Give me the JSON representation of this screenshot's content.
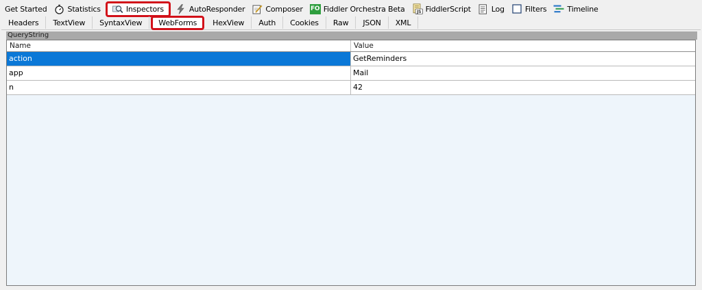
{
  "top_tabs": [
    {
      "label": "Get Started",
      "icon": "none"
    },
    {
      "label": "Statistics",
      "icon": "stopwatch-icon"
    },
    {
      "label": "Inspectors",
      "icon": "magnifier-icon",
      "active": true
    },
    {
      "label": "AutoResponder",
      "icon": "lightning-icon"
    },
    {
      "label": "Composer",
      "icon": "pencil-page-icon"
    },
    {
      "label": "Fiddler Orchestra Beta",
      "icon": "fo-icon",
      "icon_text": "FO"
    },
    {
      "label": "FiddlerScript",
      "icon": "js-script-icon",
      "icon_text": "JS"
    },
    {
      "label": "Log",
      "icon": "log-page-icon"
    },
    {
      "label": "Filters",
      "icon": "checkbox-icon"
    },
    {
      "label": "Timeline",
      "icon": "timeline-icon"
    }
  ],
  "sub_tabs": [
    {
      "label": "Headers"
    },
    {
      "label": "TextView"
    },
    {
      "label": "SyntaxView"
    },
    {
      "label": "WebForms",
      "active": true
    },
    {
      "label": "HexView"
    },
    {
      "label": "Auth"
    },
    {
      "label": "Cookies"
    },
    {
      "label": "Raw"
    },
    {
      "label": "JSON"
    },
    {
      "label": "XML"
    }
  ],
  "panel": {
    "title": "QueryString",
    "columns": {
      "name": "Name",
      "value": "Value"
    },
    "rows": [
      {
        "name": "action",
        "value": "GetReminders",
        "selected": true
      },
      {
        "name": "app",
        "value": "Mail"
      },
      {
        "name": "n",
        "value": "42"
      }
    ]
  },
  "colors": {
    "highlight_border": "#d21019",
    "selection": "#0b78d7",
    "grid_background": "#eef5fb",
    "panel_header": "#a9a9a9",
    "fo_icon_bg": "#2e9e3e"
  }
}
